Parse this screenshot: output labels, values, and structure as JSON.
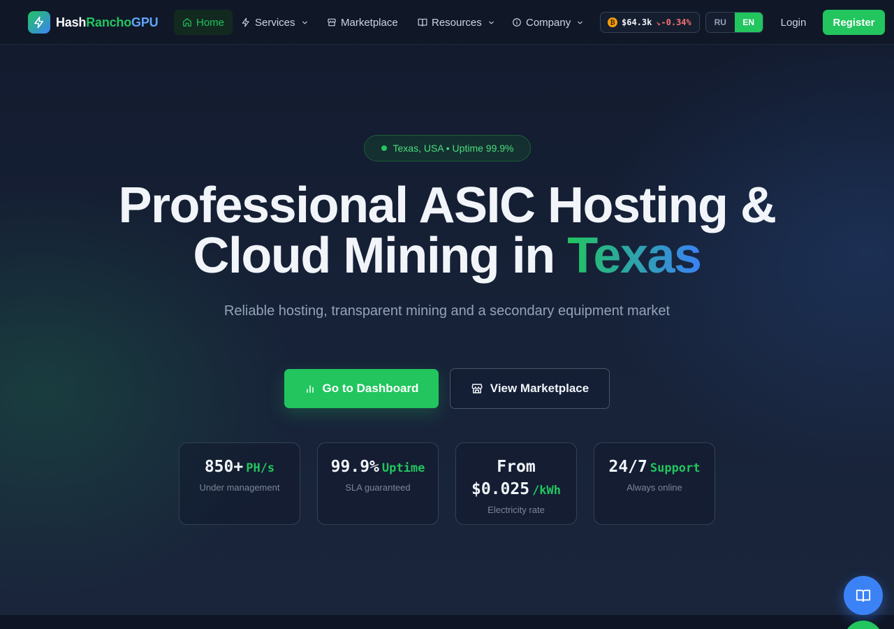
{
  "brand": {
    "part1": "Hash",
    "part2": "Rancho",
    "part3": "GPU"
  },
  "nav": {
    "items": [
      {
        "label": "Home",
        "icon": "home-icon",
        "active": true
      },
      {
        "label": "Services",
        "icon": "bolt-icon",
        "dropdown": true
      },
      {
        "label": "Marketplace",
        "icon": "store-icon"
      },
      {
        "label": "Resources",
        "icon": "book-icon",
        "dropdown": true
      },
      {
        "label": "Company",
        "icon": "info-icon",
        "dropdown": true
      }
    ],
    "ticker": {
      "coin_symbol": "₿",
      "price": "$64.3k",
      "change": "-0.34%"
    },
    "languages": [
      "RU",
      "EN"
    ],
    "active_language": "EN",
    "login": "Login",
    "register": "Register"
  },
  "hero": {
    "badge": "Texas, USA • Uptime 99.9%",
    "title_line1": "Professional ASIC Hosting &",
    "title_line2_prefix": "Cloud Mining in ",
    "title_line2_accent": "Texas",
    "subtitle": "Reliable hosting, transparent mining and a secondary equipment market",
    "primary_cta": "Go to Dashboard",
    "secondary_cta": "View Marketplace"
  },
  "stats": [
    {
      "value": "850+",
      "unit": "PH/s",
      "label": "Under management"
    },
    {
      "value": "99.9%",
      "unit": "Uptime",
      "label": "SLA guaranteed"
    },
    {
      "value_line1": "From",
      "value": "$0.025",
      "unit": "/kWh",
      "label": "Electricity rate"
    },
    {
      "value": "24/7",
      "unit": "Support",
      "label": "Always online"
    }
  ],
  "colors": {
    "accent_green": "#22c55e",
    "accent_blue": "#3b82f6",
    "background": "#0f172a"
  }
}
